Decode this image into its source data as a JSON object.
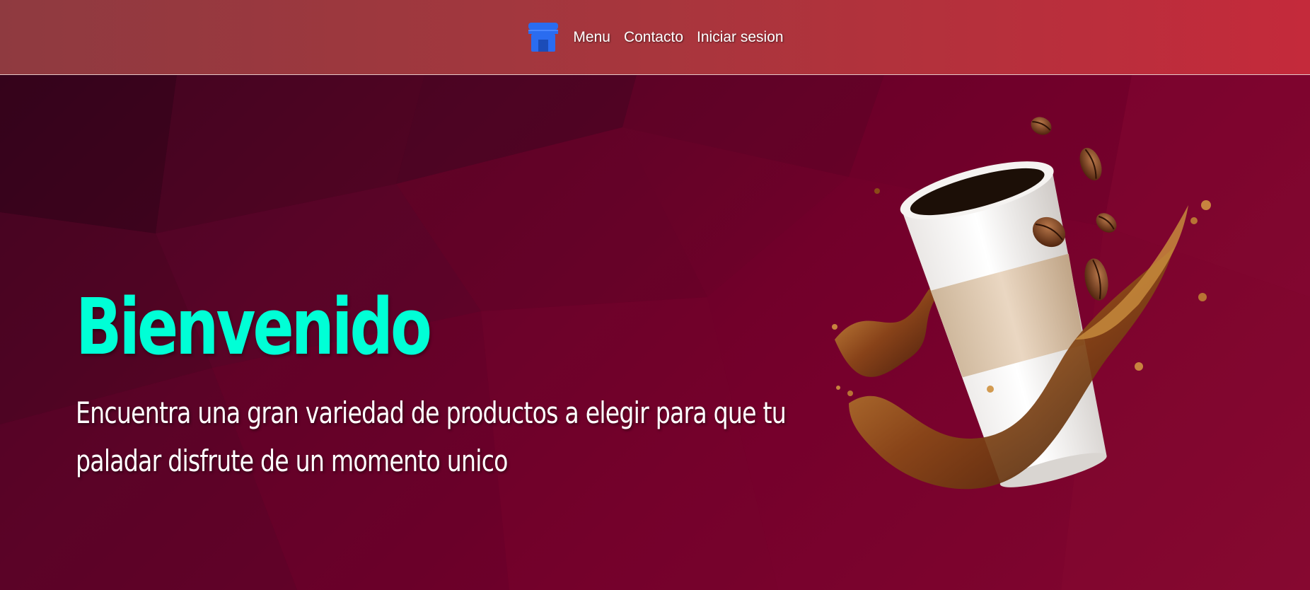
{
  "header": {
    "nav": {
      "store_icon": "store-icon",
      "links": [
        "Menu",
        "Contacto",
        "Iniciar sesion"
      ]
    }
  },
  "hero": {
    "title": "Bienvenido",
    "subtitle": "Encuentra una gran variedad de productos a elegir para que tu paladar disfrute de un momento unico",
    "image": "coffee-cup-splash-image"
  },
  "colors": {
    "header_start": "#8f3a40",
    "header_end": "#c42a3b",
    "background": "#72002a",
    "title": "#00ffd6",
    "subtitle": "#ffffff",
    "icon": "#2a6cf0"
  }
}
